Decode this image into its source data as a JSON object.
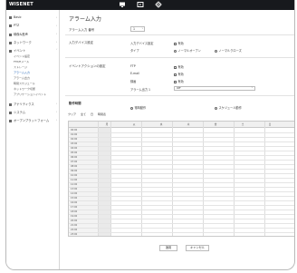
{
  "app": {
    "logo": "WISENET"
  },
  "topbar": {
    "icons": [
      "monitor-icon",
      "playback-icon",
      "settings-icon"
    ]
  },
  "sidebar": {
    "items": [
      {
        "label": "Basic",
        "icon": "home-icon"
      },
      {
        "label": "PTZ",
        "icon": "ptz-icon"
      },
      {
        "label": "映像&音声",
        "icon": "video-icon"
      },
      {
        "label": "ネットワーク",
        "icon": "network-icon"
      },
      {
        "label": "イベント",
        "icon": "event-icon"
      },
      {
        "label": "アナリティクス",
        "icon": "analytics-icon"
      },
      {
        "label": "システム",
        "icon": "system-icon"
      },
      {
        "label": "オープンプラットフォーム",
        "icon": "open-platform-icon"
      }
    ],
    "sub_items": [
      "イベント設定",
      "FTP/Eメール",
      "ストレージ",
      "アラーム入力",
      "アラーム出力",
      "時間スケジュール",
      "ネットワーク切断",
      "アプリケーションイベント"
    ]
  },
  "page": {
    "title": "アラーム入力"
  },
  "alarm_no": {
    "label": "アラーム入力 番号",
    "value": "1"
  },
  "input_settings": {
    "label": "入力デバイス設定",
    "enable_label": "入力デバイス設定",
    "enable_value": "有効",
    "type_label": "タイプ",
    "type_normally_open": "ノーマルオープン",
    "type_normally_closed": "ノーマルクローズ"
  },
  "event_action": {
    "label": "イベントアクションの設定",
    "ftp_label": "FTP",
    "ftp_value": "有効",
    "email_label": "E-mail",
    "email_value": "有効",
    "record_label": "録画",
    "record_value": "有効",
    "alarm_out_label": "アラーム出力 1",
    "alarm_out_value": "Off"
  },
  "activation": {
    "label": "動作時間",
    "option_always": "常時動作",
    "option_schedule": "スケジュール動作",
    "tabs": [
      "クリア",
      "全て",
      "日",
      "時間表"
    ]
  },
  "schedule_grid": {
    "columns": [
      "",
      "月",
      "火",
      "水",
      "木",
      "金",
      "土",
      "日"
    ],
    "rows": [
      "00:00",
      "01:00",
      "02:00",
      "03:00",
      "04:00",
      "05:00",
      "06:00",
      "07:00",
      "08:00",
      "09:00",
      "10:00",
      "11:00",
      "12:00",
      "13:00",
      "14:00",
      "15:00",
      "16:00",
      "17:00",
      "18:00",
      "19:00",
      "20:00",
      "21:00",
      "22:00",
      "23:00"
    ]
  },
  "footer": {
    "apply_label": "適用",
    "cancel_label": "キャンセル"
  },
  "colors": {
    "topbar": "#17191d",
    "accent": "#1a5fb4"
  }
}
